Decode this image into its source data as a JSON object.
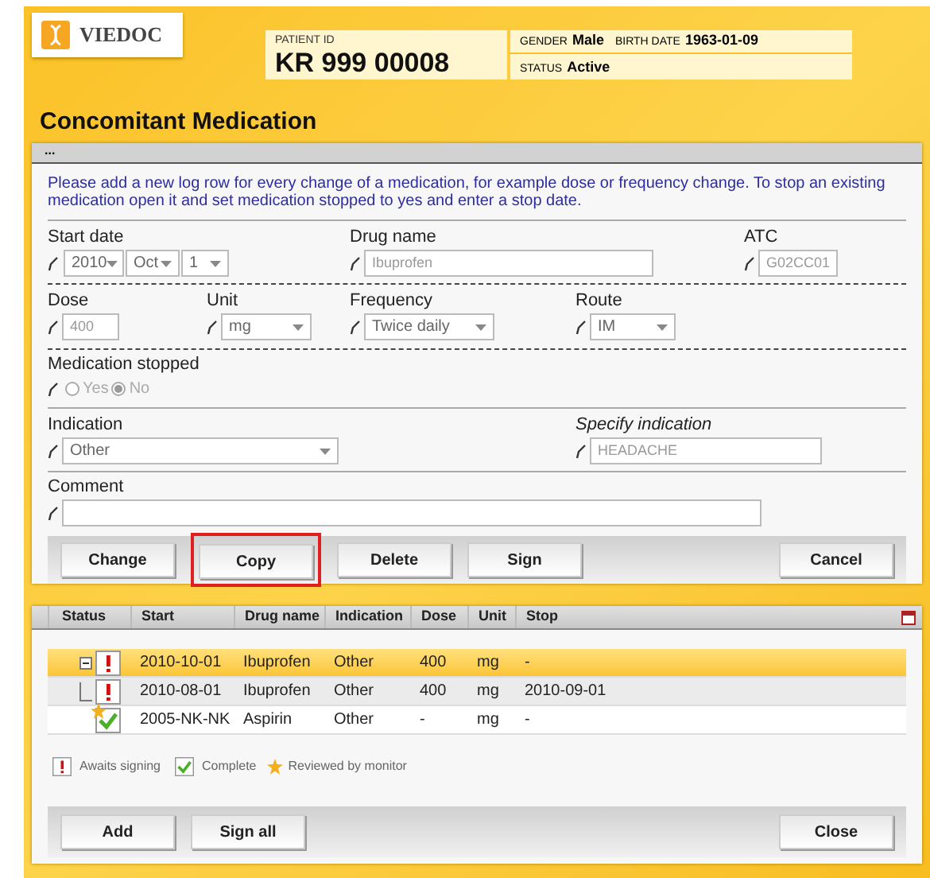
{
  "logo": {
    "text": "VIEDOC"
  },
  "patient": {
    "id_label": "PATIENT ID",
    "id": "KR 999 00008",
    "gender_label": "GENDER",
    "gender": "Male",
    "birth_label": "BIRTH DATE",
    "birth": "1963-01-09",
    "status_label": "STATUS",
    "status": "Active"
  },
  "title": "Concomitant Medication",
  "form": {
    "header": "...",
    "disabled": true,
    "instruction": "Please add a new log row for every change of a medication, for example dose or frequency change. To stop an existing medication open it and set medication stopped to yes and enter a stop date.",
    "start_date": {
      "label": "Start date",
      "year": "2010",
      "month": "Oct",
      "day": "1"
    },
    "drug_name": {
      "label": "Drug name",
      "value": "Ibuprofen"
    },
    "atc": {
      "label": "ATC",
      "value": "G02CC01"
    },
    "dose": {
      "label": "Dose",
      "value": "400"
    },
    "unit": {
      "label": "Unit",
      "value": "mg"
    },
    "frequency": {
      "label": "Frequency",
      "value": "Twice daily"
    },
    "route": {
      "label": "Route",
      "value": "IM"
    },
    "stopped": {
      "label": "Medication stopped",
      "options": [
        {
          "label": "Yes",
          "selected": false
        },
        {
          "label": "No",
          "selected": true
        }
      ]
    },
    "indication": {
      "label": "Indication",
      "value": "Other"
    },
    "specify": {
      "label": "Specify indication",
      "value": "HEADACHE"
    },
    "comment": {
      "label": "Comment"
    },
    "buttons": [
      {
        "label": "Change",
        "highlighted": false
      },
      {
        "label": "Copy",
        "highlighted": true
      },
      {
        "label": "Delete",
        "highlighted": false
      },
      {
        "label": "Sign",
        "highlighted": false
      },
      {
        "label": "Cancel",
        "highlighted": false
      }
    ]
  },
  "table": {
    "status_column": "Status",
    "columns": [
      "Start",
      "Drug name",
      "Indication",
      "Dose",
      "Unit",
      "Stop"
    ],
    "rows": [
      {
        "kind": "awaits_signing",
        "reviewed": false,
        "selected": true,
        "expanded": true,
        "cells": [
          "2010-10-01",
          "Ibuprofen",
          "Other",
          "400",
          "mg",
          "-"
        ],
        "children": [
          {
            "kind": "awaits_signing",
            "reviewed": false,
            "selected": false,
            "cells": [
              "2010-08-01",
              "Ibuprofen",
              "Other",
              "400",
              "mg",
              "2010-09-01"
            ]
          }
        ]
      },
      {
        "kind": "complete",
        "reviewed": true,
        "selected": false,
        "cells": [
          "2005-NK-NK",
          "Aspirin",
          "Other",
          "-",
          "mg",
          "-"
        ]
      }
    ],
    "legend": [
      {
        "kind": "awaits_signing",
        "label": "Awaits signing"
      },
      {
        "kind": "complete",
        "label": "Complete"
      },
      {
        "kind": "reviewed",
        "label": "Reviewed by monitor"
      }
    ],
    "buttons": [
      {
        "label": "Add"
      },
      {
        "label": "Sign all"
      },
      {
        "label": "Close"
      }
    ]
  }
}
